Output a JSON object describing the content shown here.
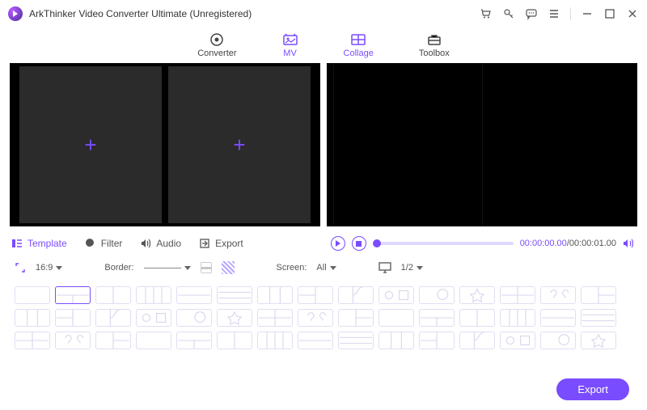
{
  "app": {
    "title": "ArkThinker Video Converter Ultimate (Unregistered)"
  },
  "tabs": {
    "converter": "Converter",
    "mv": "MV",
    "collage": "Collage",
    "toolbox": "Toolbox",
    "active": "Collage"
  },
  "mid": {
    "template": "Template",
    "filter": "Filter",
    "audio": "Audio",
    "export": "Export"
  },
  "time": {
    "current": "00:00:00.00",
    "total": "00:00:01.00"
  },
  "opts": {
    "ratio_icon": "aspect-icon",
    "ratio": "16:9",
    "border_label": "Border:",
    "screen_label": "Screen:",
    "screen_value": "All",
    "page": "1/2"
  },
  "footer": {
    "export": "Export"
  },
  "icons": {
    "cart": "cart-icon",
    "key": "key-icon",
    "chat": "chat-icon",
    "menu": "menu-icon",
    "min": "minimize-icon",
    "max": "maximize-icon",
    "close": "close-icon",
    "play": "play-icon",
    "stop": "stop-icon",
    "volume": "volume-icon",
    "monitor": "monitor-icon"
  },
  "templates_rows": 3,
  "templates_cols": 15,
  "selected_template_index": 1,
  "colors": {
    "accent": "#7a4cff"
  }
}
